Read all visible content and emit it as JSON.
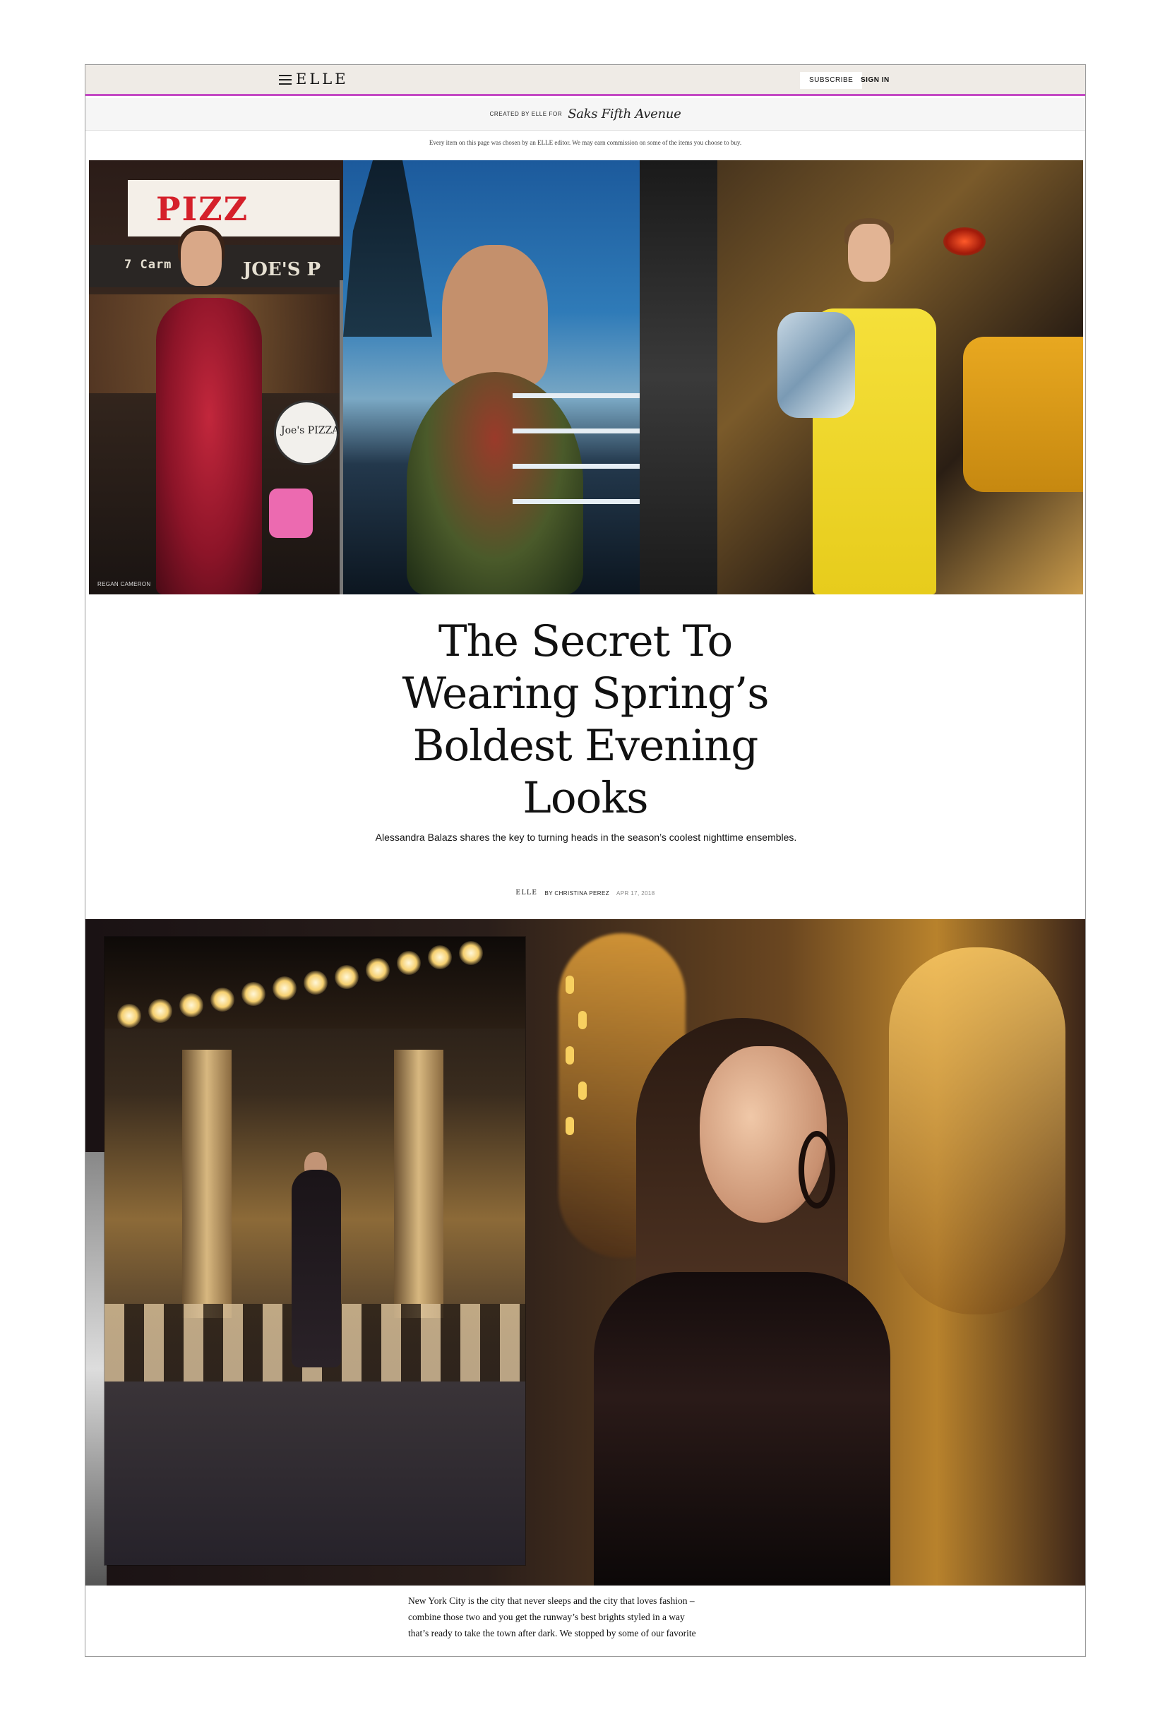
{
  "header": {
    "logo": "ELLE",
    "subscribe_label": "SUBSCRIBE",
    "signin_label": "SIGN IN"
  },
  "sponsor": {
    "label": "CREATED BY ELLE FOR",
    "brand": "Saks Fifth Avenue"
  },
  "disclaimer": "Every item on this page was chosen by an ELLE editor. We may earn commission on some of the items you choose to buy.",
  "hero": {
    "photo_credit": "REGAN CAMERON"
  },
  "article": {
    "title_lines": [
      "The Secret To",
      "Wearing Spring’s",
      "Boldest Evening",
      "Looks"
    ],
    "dek": "Alessandra Balazs shares the key to turning heads in the season’s coolest nighttime ensembles.",
    "byline": {
      "publication": "ELLE",
      "author": "BY CHRISTINA PEREZ",
      "date": "APR 17, 2018"
    },
    "body_lines": [
      "New York City is the city that never sleeps and the city that loves fashion –",
      "combine those two and you get the runway’s best brights styled in a way",
      "that’s ready to take the town after dark. We stopped by some of our favorite"
    ]
  },
  "colors": {
    "nav_background": "#efebe6",
    "nav_accent_line": "#c44ac4",
    "text": "#111111"
  },
  "icons": {
    "menu": "hamburger-menu-icon"
  }
}
